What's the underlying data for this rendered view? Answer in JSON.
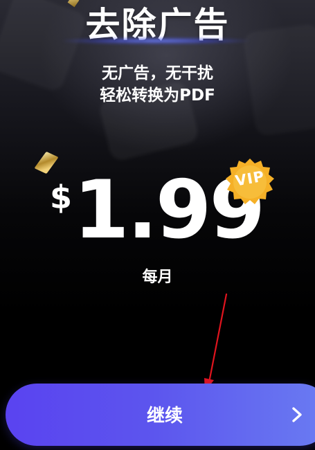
{
  "header": {
    "title": "去除广告",
    "subtitle_line1": "无广告，无干扰",
    "subtitle_line2": "轻松转换为PDF"
  },
  "offer": {
    "currency": "$",
    "price": "1.99",
    "period": "每月",
    "badge": "VIP"
  },
  "actions": {
    "continue_label": "继续",
    "continue_icon": "chevron-right-icon"
  },
  "colors": {
    "button_start": "#5a43f0",
    "button_end": "#6a7cf2",
    "badge": "#f5b027",
    "annotation_arrow": "#e0141e",
    "background": "#000000"
  }
}
